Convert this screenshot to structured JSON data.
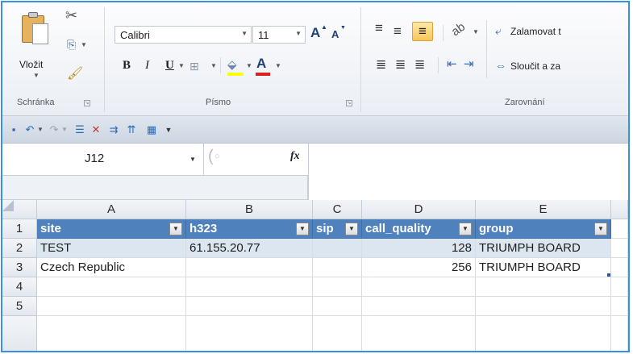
{
  "ribbon": {
    "clipboard": {
      "paste_label": "Vložit",
      "group_label": "Schránka"
    },
    "font": {
      "font_name": "Calibri",
      "font_size": "11",
      "bold": "B",
      "italic": "I",
      "underline": "U",
      "grow": "A",
      "shrink": "A",
      "font_color_letter": "A",
      "group_label": "Písmo",
      "fill_color": "#ffff00",
      "font_color": "#e02020"
    },
    "alignment": {
      "wrap_text": "Zalamovat t",
      "merge_center": "Sloučit a za",
      "group_label": "Zarovnání"
    }
  },
  "formula_bar": {
    "name_box": "J12",
    "fx": "fx",
    "formula": ""
  },
  "sheet": {
    "column_headers": [
      "A",
      "B",
      "C",
      "D",
      "E"
    ],
    "row_headers": [
      "1",
      "2",
      "3",
      "4",
      "5"
    ],
    "table_headers": [
      "site",
      "h323",
      "sip",
      "call_quality",
      "group"
    ],
    "rows": [
      [
        "TEST",
        "61.155.20.77",
        "",
        "128",
        "TRIUMPH BOARD"
      ],
      [
        "Czech Republic",
        "",
        "",
        "256",
        "TRIUMPH BOARD"
      ]
    ],
    "header_color": "#4f81bd",
    "band_color": "#dce6f1"
  },
  "icons": {
    "undo": "undo-icon",
    "redo": "redo-icon",
    "save": "save-icon"
  }
}
